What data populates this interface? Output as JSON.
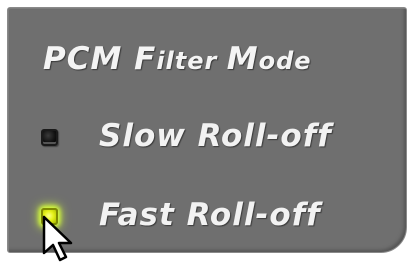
{
  "panel": {
    "title_main": "PCM F",
    "title_parts": [
      "PCM ",
      "F",
      "ilter ",
      "M",
      "ode"
    ],
    "options": [
      {
        "label": "Slow Roll-off",
        "selected": false,
        "indicator_color": "#000000"
      },
      {
        "label": "Fast Roll-off",
        "selected": true,
        "indicator_color": "#e6f21a"
      }
    ]
  },
  "colors": {
    "panel_background": "#6f6f6f",
    "text": "#f2f2f2",
    "led_on": "#e6f21a",
    "led_off": "#000000"
  },
  "icons": {
    "cursor": "mouse-pointer-arrow-icon"
  }
}
